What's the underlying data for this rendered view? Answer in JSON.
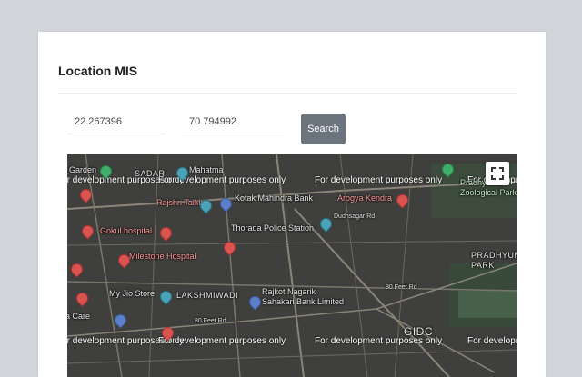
{
  "page": {
    "title": "Location MIS"
  },
  "form": {
    "latitude_value": "22.267396",
    "longitude_value": "70.794992",
    "search_label": "Search"
  },
  "map": {
    "watermark": "For development purposes only",
    "labels": {
      "garden": "Garden",
      "sadar": "SADAR",
      "mahatma": "Mahatma",
      "rajshri_talkies": "Rajshri Talkies",
      "kotak": "Kotak Mahindra Bank",
      "arogya": "Arogya Kendra",
      "pradhyuman_zoo": "Pradhyuman\nZoological Park, Rajkot",
      "dudhsagar_rd": "Dudhsagar Rd",
      "gokul_hospital": "Gokul hospital",
      "thorada": "Thorada Police Station",
      "pradhyuman_park": "PRADHYUMAN\nPARK",
      "milestone": "Milestone Hospital",
      "my_jio": "My Jio Store",
      "lakshmiwadi": "LAKSHMIWADI",
      "rajkot_bank": "Rajkot Nagarik\nSahakari Bank Limited",
      "care": "a Care",
      "feet_80_a": "80 Feet Rd",
      "feet_80_b": "80 Feet Rd",
      "gidc": "GIDC"
    }
  },
  "icons": {
    "fullscreen": "fullscreen-icon",
    "hospital_pin": "hospital-pin-icon"
  },
  "colors": {
    "search_button": "#6c757d",
    "page_bg": "#d1d5d9",
    "map_bg": "#3f3f3d"
  }
}
